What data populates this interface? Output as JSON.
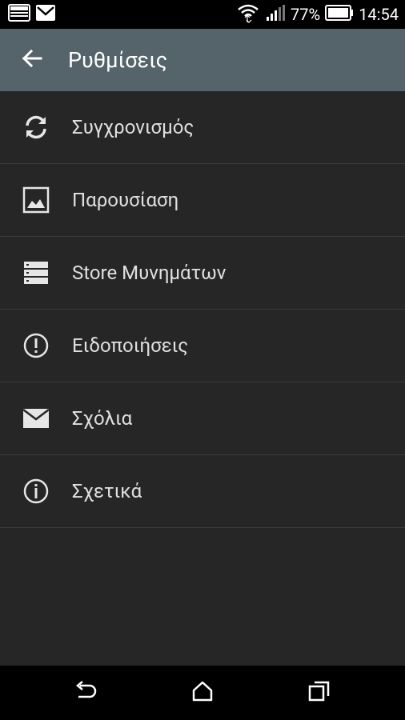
{
  "status_bar": {
    "battery_percent": "77%",
    "time": "14:54"
  },
  "app_bar": {
    "title": "Ρυθμίσεις"
  },
  "menu": {
    "items": [
      {
        "label": "Συγχρονισμός",
        "icon": "sync-icon"
      },
      {
        "label": "Παρουσίαση",
        "icon": "image-icon"
      },
      {
        "label": "Store Μυνημάτων",
        "icon": "storage-icon"
      },
      {
        "label": "Ειδοποιήσεις",
        "icon": "alert-icon"
      },
      {
        "label": "Σχόλια",
        "icon": "mail-icon"
      },
      {
        "label": "Σχετικά",
        "icon": "info-icon"
      }
    ]
  },
  "colors": {
    "app_bar": "#54646a",
    "background": "#262626",
    "status_bar": "#000000"
  }
}
